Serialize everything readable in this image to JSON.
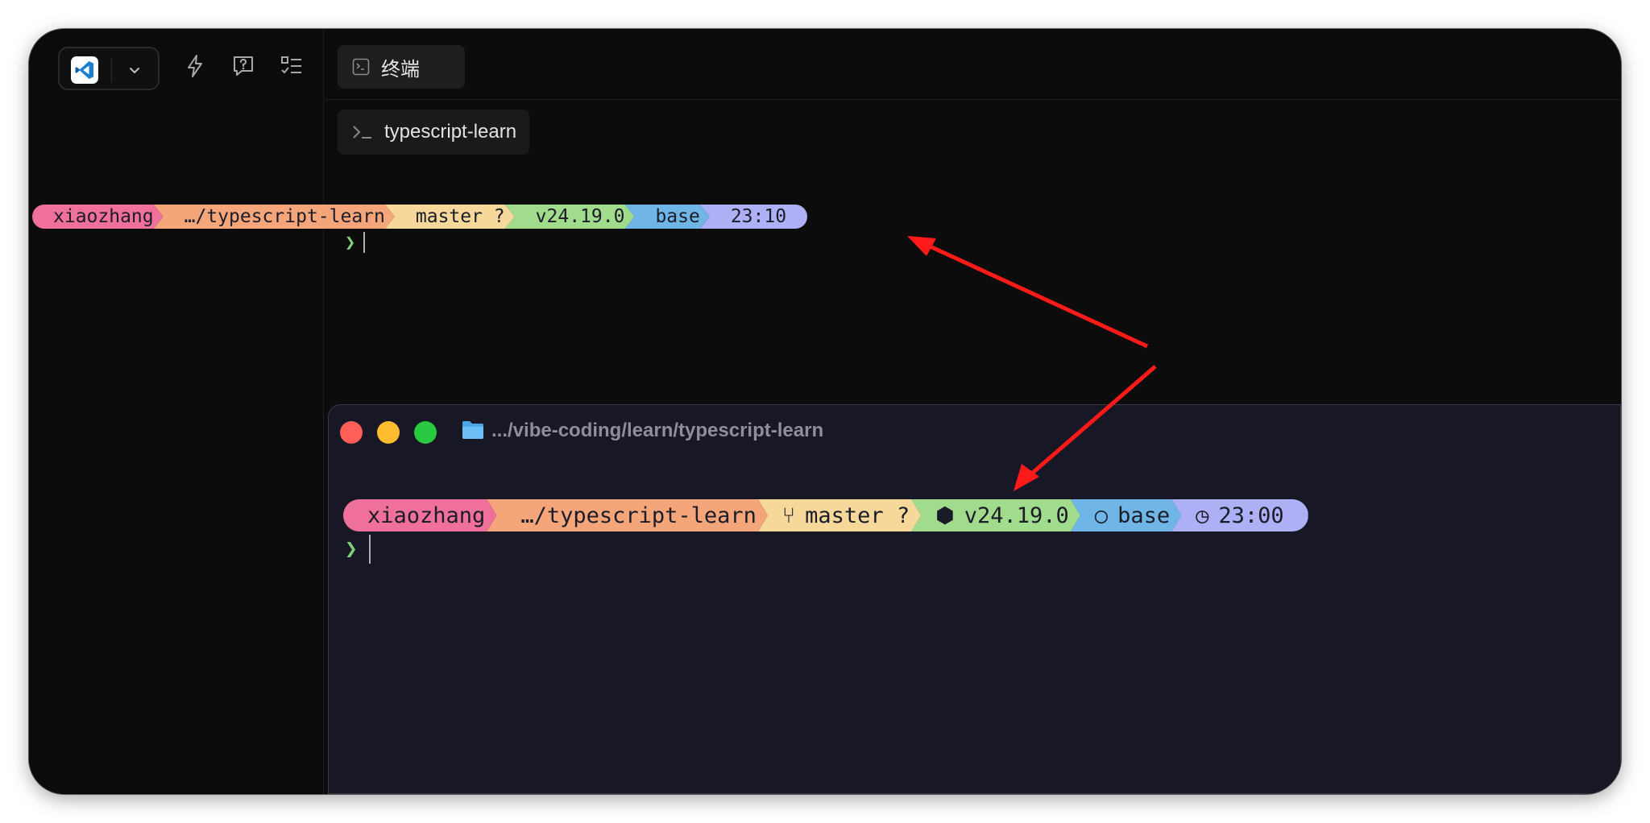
{
  "sidebar": {
    "app_icon": "vscode-icon",
    "dropdown_icon": "chevron-down-icon",
    "tools": [
      "lightning-icon",
      "help-icon",
      "checklist-icon"
    ]
  },
  "main": {
    "tab": {
      "label": "终端",
      "icon": "terminal-icon"
    },
    "session": {
      "label": "typescript-learn",
      "icon": "prompt-icon"
    }
  },
  "terminal_prompt": {
    "segments": [
      {
        "glyph": "",
        "text": "xiaozhang",
        "color": "#f0709c"
      },
      {
        "glyph": "",
        "text": "…/typescript-learn",
        "color": "#f4a57a"
      },
      {
        "glyph": "",
        "text": "master ?",
        "color": "#f5d89a"
      },
      {
        "glyph": "",
        "text": "v24.19.0",
        "color": "#a0dc8c"
      },
      {
        "glyph": "",
        "text": "base",
        "color": "#6fb6e6"
      },
      {
        "glyph": "",
        "text": "23:10",
        "color": "#aeb0f6"
      }
    ],
    "caret": "❯"
  },
  "overlay_terminal": {
    "title": ".../vibe-coding/learn/typescript-learn",
    "traffic_lights": [
      "#ff5f57",
      "#febc2e",
      "#28c840"
    ],
    "segments": [
      {
        "glyph": "",
        "text": "xiaozhang",
        "color": "#f0709c"
      },
      {
        "glyph": "",
        "text": "…/typescript-learn",
        "color": "#f4a57a"
      },
      {
        "glyph": "⑂",
        "text": "master ?",
        "color": "#f5d89a"
      },
      {
        "glyph": "⬢",
        "text": "v24.19.0",
        "color": "#a0dc8c"
      },
      {
        "glyph": "○",
        "text": "base",
        "color": "#6fb6e6"
      },
      {
        "glyph": "◷",
        "text": "23:00",
        "color": "#aeb0f6"
      }
    ],
    "caret": "❯"
  },
  "annotation": {
    "arrow_color": "#ff1a1a"
  }
}
